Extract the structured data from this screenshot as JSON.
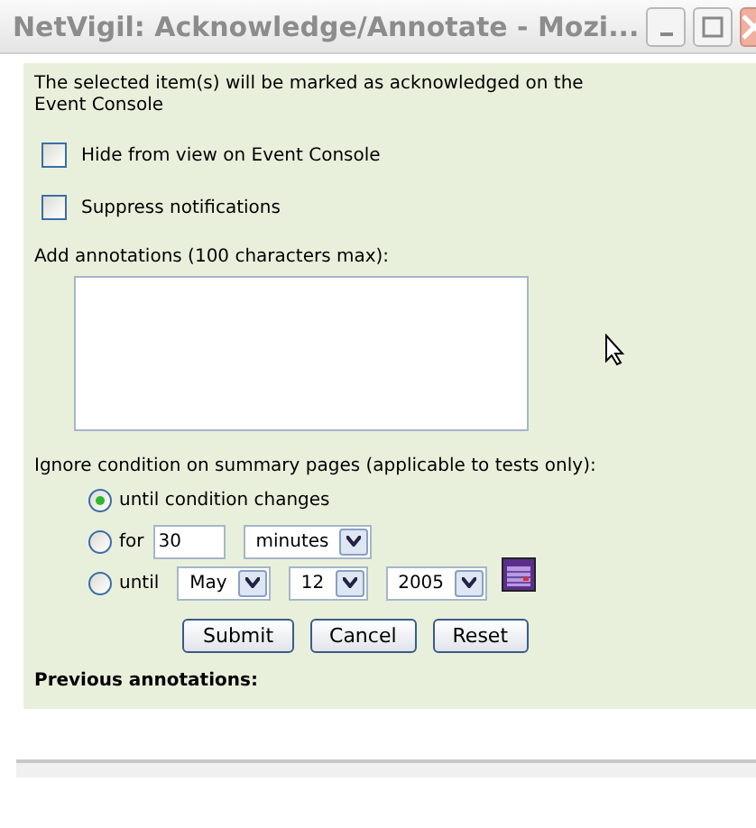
{
  "window": {
    "title": "NetVigil: Acknowledge/Annotate - Mozi..."
  },
  "intro": "The selected item(s) will be marked as acknowledged on the Event Console",
  "options": [
    {
      "label": "Hide from view on Event Console",
      "checked": false
    },
    {
      "label": "Suppress notifications",
      "checked": false
    }
  ],
  "annotations": {
    "label": "Add annotations (100 characters max):"
  },
  "ignore": {
    "label": "Ignore condition on summary pages (applicable to tests only):",
    "choices": [
      {
        "kind": "plain",
        "label": "until condition changes",
        "selected": true
      },
      {
        "kind": "duration",
        "label": "for",
        "value": "30",
        "unit": "minutes",
        "selected": false
      },
      {
        "kind": "date",
        "label": "until",
        "month": "May",
        "day": "12",
        "year": "2005",
        "selected": false
      }
    ]
  },
  "buttons": [
    "Submit",
    "Cancel",
    "Reset"
  ],
  "previous": {
    "label": "Previous annotations:"
  }
}
